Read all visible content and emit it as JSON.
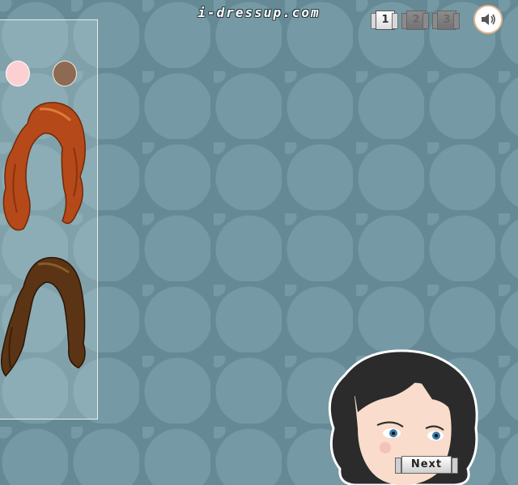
{
  "logo": {
    "text": "i-dressup.com"
  },
  "pager": {
    "pages": [
      "1",
      "2",
      "3"
    ],
    "active": "1"
  },
  "sound": {
    "icon": "speaker-icon"
  },
  "panel": {
    "swatches": [
      {
        "name": "pink-swatch",
        "color": "#fcd0d3"
      },
      {
        "name": "brown-swatch",
        "color": "#8e6a53"
      }
    ],
    "hairstyles": [
      {
        "name": "hair-option-auburn-wavy",
        "color": "#b5491a"
      },
      {
        "name": "hair-option-brown-long",
        "color": "#5a3414"
      }
    ]
  },
  "buttons": {
    "next_label": "Next"
  },
  "colors": {
    "background": "#658a95",
    "circle": "#759aa5",
    "panel_border": "#e6eef0"
  }
}
